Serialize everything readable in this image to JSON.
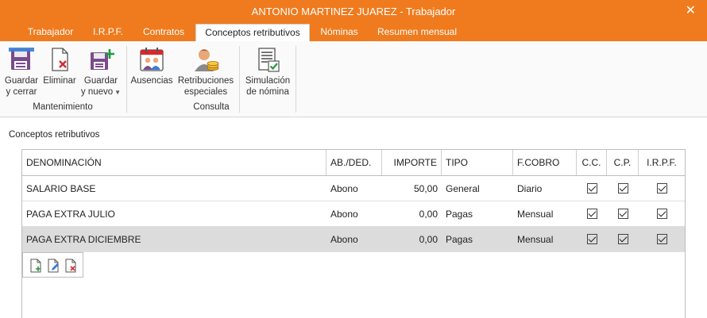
{
  "window": {
    "title": "ANTONIO MARTINEZ JUAREZ - Trabajador",
    "close_glyph": "✕"
  },
  "tabs": [
    {
      "label": "Trabajador"
    },
    {
      "label": "I.R.P.F."
    },
    {
      "label": "Contratos"
    },
    {
      "label": "Conceptos retributivos",
      "active": true
    },
    {
      "label": "Nóminas"
    },
    {
      "label": "Resumen mensual"
    }
  ],
  "ribbon": {
    "groups": {
      "mantenimiento": "Mantenimiento",
      "consulta": "Consulta"
    },
    "buttons": {
      "guardar_cerrar": {
        "line1": "Guardar",
        "line2": "y cerrar",
        "icon": "save-close-icon"
      },
      "eliminar": {
        "line1": "Eliminar",
        "icon": "delete-document-icon"
      },
      "guardar_nuevo": {
        "line1": "Guardar",
        "line2": "y nuevo",
        "icon": "save-new-icon"
      },
      "ausencias": {
        "line1": "Ausencias",
        "icon": "calendar-people-icon"
      },
      "retribuciones": {
        "line1": "Retribuciones",
        "line2": "especiales",
        "icon": "person-coins-icon"
      },
      "simulacion": {
        "line1": "Simulación",
        "line2": "de nómina",
        "icon": "payroll-check-icon"
      }
    }
  },
  "section_title": "Conceptos retributivos",
  "table": {
    "headers": {
      "denominacion": "DENOMINACIÓN",
      "abded": "AB./DED.",
      "importe": "IMPORTE",
      "tipo": "TIPO",
      "fcobro": "F.COBRO",
      "cc": "C.C.",
      "cp": "C.P.",
      "irpf": "I.R.P.F."
    },
    "rows": [
      {
        "denominacion": "SALARIO BASE",
        "abded": "Abono",
        "importe": "50,00",
        "tipo": "General",
        "fcobro": "Diario",
        "cc": true,
        "cp": true,
        "irpf": true
      },
      {
        "denominacion": "PAGA EXTRA JULIO",
        "abded": "Abono",
        "importe": "0,00",
        "tipo": "Pagas",
        "fcobro": "Mensual",
        "cc": true,
        "cp": true,
        "irpf": true
      },
      {
        "denominacion": "PAGA EXTRA DICIEMBRE",
        "abded": "Abono",
        "importe": "0,00",
        "tipo": "Pagas",
        "fcobro": "Mensual",
        "cc": true,
        "cp": true,
        "irpf": true,
        "selected": true
      }
    ]
  },
  "colors": {
    "accent": "#ef7b1e",
    "selected_row": "#dcdcdc"
  }
}
